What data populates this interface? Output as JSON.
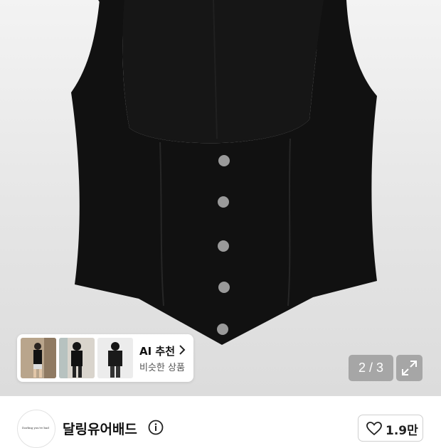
{
  "gallery": {
    "counter": "2 / 3"
  },
  "ai_recommend": {
    "title": "AI 추천",
    "subtitle": "비슷한 상품"
  },
  "shop": {
    "name": "달링유어배드",
    "logo_text": "Darling you're bad"
  },
  "like": {
    "count": "1.9만"
  }
}
